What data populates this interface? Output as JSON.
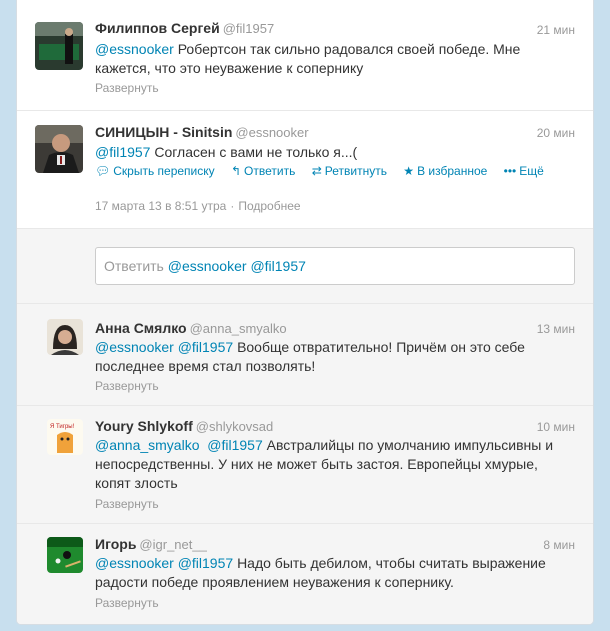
{
  "tweets": [
    {
      "fullname": "Филиппов Сергей",
      "username": "@fil1957",
      "time": "21 мин",
      "mentions": [
        "@essnooker"
      ],
      "text_line1": "Робертсон так сильно радовался своей победе. Мне",
      "text_line2": "кажется, что это неуважение к сопернику",
      "expand": "Развернуть"
    },
    {
      "fullname": "СИНИЦЫН - Sinitsin",
      "username": "@essnooker",
      "time": "20 мин",
      "mentions": [
        "@fil1957"
      ],
      "text_line1": "Согласен с вами не только я...(",
      "actions": {
        "hide_conversation": "Скрыть переписку",
        "reply": "Ответить",
        "retweet": "Ретвитнуть",
        "favorite": "В избранное",
        "more": "Ещё"
      },
      "timestamp": "17 марта 13 в 8:51 утра",
      "details": "Подробнее",
      "reply_box": {
        "prefix": "Ответить",
        "mentions": [
          "@essnooker",
          "@fil1957"
        ]
      }
    },
    {
      "fullname": "Анна Смялко",
      "username": "@anna_smyalko",
      "time": "13 мин",
      "mentions": [
        "@essnooker",
        "@fil1957"
      ],
      "text_line1": "Вообще отвратительно! Причём он это себе",
      "text_line2": "последнее время стал позволять!",
      "expand": "Развернуть"
    },
    {
      "fullname": "Youry Shlykoff",
      "username": "@shlykovsad",
      "time": "10 мин",
      "avatar_text": "Я Тигры!",
      "mentions": [
        "@anna_smyalko",
        "@fil1957"
      ],
      "text_line1": "Австралийцы по умолчанию импульсивны и",
      "text_line2": "непосредственны. У них не может быть застоя. Европейцы хмурые,",
      "text_line3": "копят злость",
      "expand": "Развернуть"
    },
    {
      "fullname": "Игорь",
      "username": "@igr_net__",
      "time": "8 мин",
      "mentions": [
        "@essnooker",
        "@fil1957"
      ],
      "text_line1": "Надо быть дебилом, чтобы считать выражение",
      "text_line2": "радости победе проявлением неуважения к сопернику.",
      "expand": "Развернуть"
    }
  ],
  "colors": {
    "link": "#0084b4",
    "muted": "#999999",
    "page_bg": "#c8dfee"
  }
}
